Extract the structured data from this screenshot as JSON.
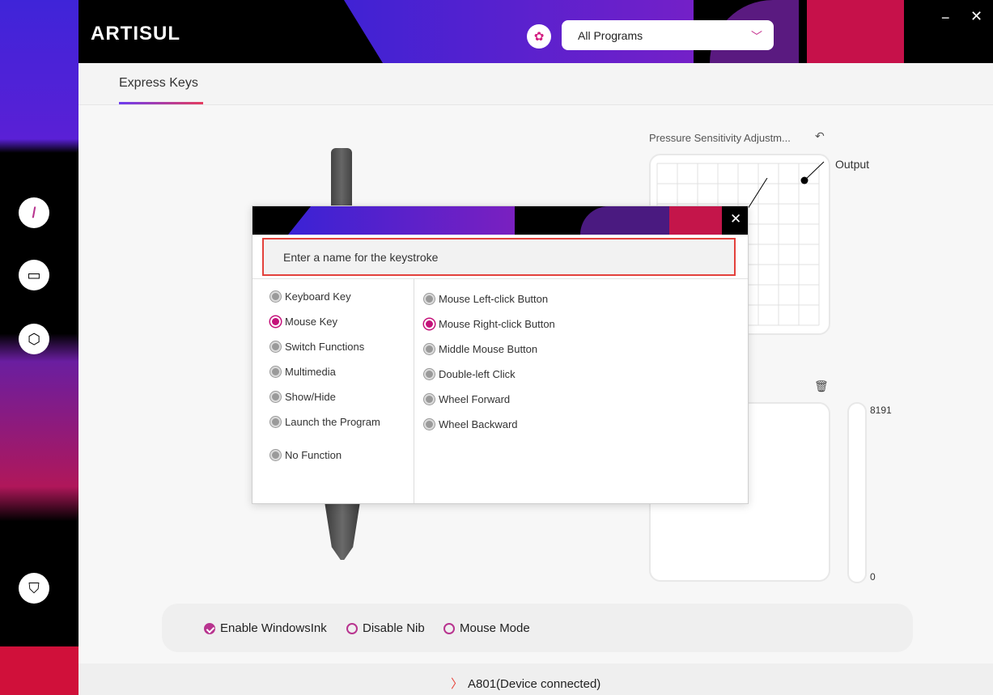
{
  "app": {
    "logo": "ARTISUL"
  },
  "header": {
    "program_icon": "flower-icon",
    "program_select": "All Programs",
    "minimize": "−",
    "close": "✕"
  },
  "tabs": [
    {
      "label": "Express Keys",
      "active": true
    }
  ],
  "sidebar": [
    {
      "icon": "pen-icon"
    },
    {
      "icon": "display-icon"
    },
    {
      "icon": "hexagon-icon"
    },
    {
      "icon": "weight-icon"
    }
  ],
  "pressure": {
    "title": "Pressure Sensitivity Adjustm...",
    "output_label": "Output",
    "slider_max": "8191",
    "slider_min": "0"
  },
  "options": {
    "enable_windowsink": "Enable WindowsInk",
    "disable_nib": "Disable Nib",
    "mouse_mode": "Mouse Mode"
  },
  "status": {
    "text": "A801(Device connected)"
  },
  "dialog": {
    "close": "✕",
    "placeholder": "Enter a name for the keystroke",
    "categories": [
      "Keyboard Key",
      "Mouse Key",
      "Switch Functions",
      "Multimedia",
      "Show/Hide",
      "Launch the Program",
      "No Function"
    ],
    "mouse_options": [
      "Mouse Left-click Button",
      "Mouse Right-click Button",
      "Middle Mouse Button",
      "Double-left Click",
      "Wheel Forward",
      "Wheel Backward"
    ]
  },
  "colors": {
    "accent": "#c4117a",
    "red": "#e3413c",
    "purple": "#3a22d5"
  }
}
